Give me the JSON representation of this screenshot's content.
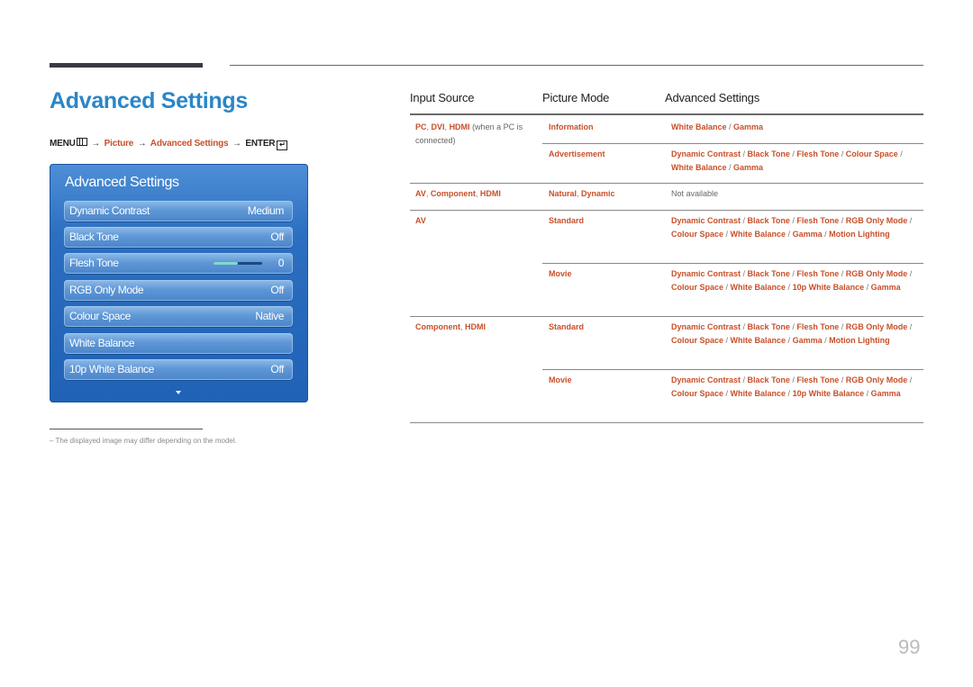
{
  "page": {
    "title": "Advanced Settings",
    "page_number": "99"
  },
  "breadcrumb": {
    "menu": "MENU",
    "menu_icon": "menu-icon",
    "arrow": "→",
    "step1": "Picture",
    "step2": "Advanced Settings",
    "enter": "ENTER",
    "enter_icon": "enter-icon"
  },
  "osd": {
    "title": "Advanced Settings",
    "items": [
      {
        "label": "Dynamic Contrast",
        "value": "Medium"
      },
      {
        "label": "Black Tone",
        "value": "Off"
      },
      {
        "label": "Flesh Tone",
        "value": "0",
        "slider_fraction": 0.5
      },
      {
        "label": "RGB Only Mode",
        "value": "Off"
      },
      {
        "label": "Colour Space",
        "value": "Native"
      },
      {
        "label": "White Balance",
        "value": ""
      },
      {
        "label": "10p White Balance",
        "value": "Off"
      }
    ],
    "more_icon": "chevron-down-icon"
  },
  "footnote": "–  The displayed image may differ depending on the model.",
  "table": {
    "headers": [
      "Input Source",
      "Picture Mode",
      "Advanced Settings"
    ],
    "rows": [
      {
        "source": "PC, DVI, HDMI",
        "source_note": "(when a PC is connected)",
        "mode": "Information",
        "settings": "White Balance / Gamma"
      },
      {
        "source": "",
        "mode": "Advertisement",
        "settings": "Dynamic Contrast / Black Tone / Flesh Tone / Colour Space / White Balance / Gamma"
      },
      {
        "source": "AV, Component, HDMI",
        "mode": "Natural, Dynamic",
        "settings": "Not available"
      },
      {
        "source": "AV",
        "mode": "Standard",
        "settings": "Dynamic Contrast / Black Tone / Flesh Tone / RGB Only Mode / Colour Space / White Balance / Gamma / Motion Lighting"
      },
      {
        "source": "",
        "mode": "Movie",
        "settings": "Dynamic Contrast / Black Tone / Flesh Tone / RGB Only Mode / Colour Space / White Balance / 10p White Balance / Gamma"
      },
      {
        "source": "Component, HDMI",
        "mode": "Standard",
        "settings": "Dynamic Contrast / Black Tone / Flesh Tone / RGB Only Mode / Colour Space / White Balance / Gamma / Motion Lighting"
      },
      {
        "source": "",
        "mode": "Movie",
        "settings": "Dynamic Contrast / Black Tone / Flesh Tone / RGB Only Mode / Colour Space / White Balance / 10p White Balance / Gamma"
      }
    ]
  },
  "colors": {
    "title_blue": "#2a86c8",
    "accent_orange": "#c8502a",
    "osd_blue": "#1f62b6"
  }
}
